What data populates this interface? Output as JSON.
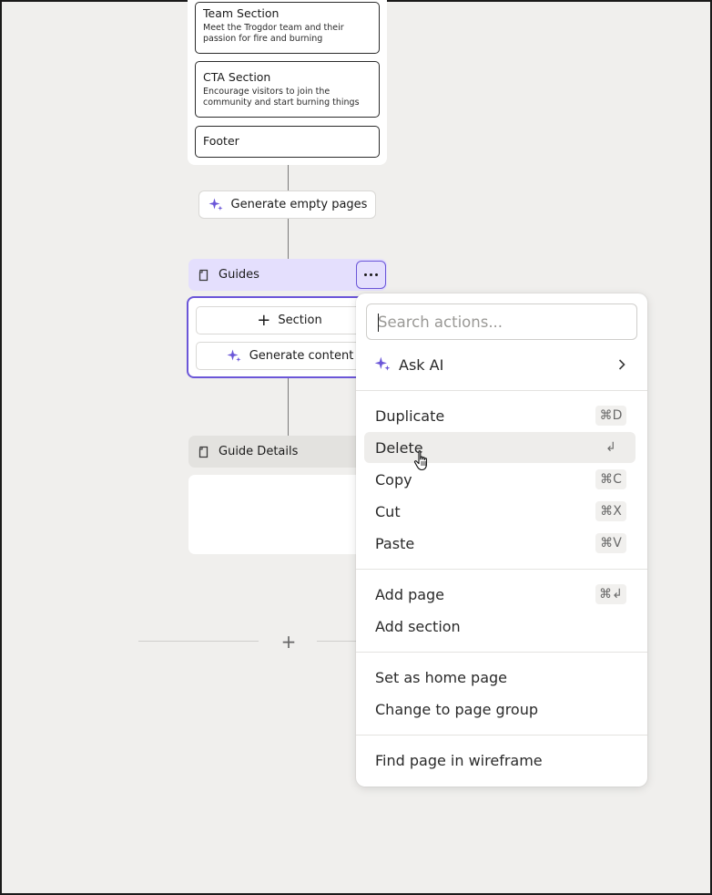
{
  "sitemap": {
    "sections": [
      {
        "title": "Team Section",
        "desc": "Meet the Trogdor team and their passion for fire and burning"
      },
      {
        "title": "CTA Section",
        "desc": "Encourage visitors to join the community and start burning things"
      },
      {
        "title": "Footer",
        "desc": ""
      }
    ],
    "generate_pages_label": "Generate empty pages",
    "guides_title": "Guides",
    "section_button_label": "Section",
    "generate_content_label": "Generate content",
    "guide_details_title": "Guide Details",
    "add_glyph": "+"
  },
  "menu": {
    "search_placeholder": "Search actions...",
    "ask_ai_label": "Ask AI",
    "items": [
      {
        "label": "Duplicate",
        "shortcut": "⌘D"
      },
      {
        "label": "Delete",
        "shortcut": "↲"
      },
      {
        "label": "Copy",
        "shortcut": "⌘C"
      },
      {
        "label": "Cut",
        "shortcut": "⌘X"
      },
      {
        "label": "Paste",
        "shortcut": "⌘V"
      },
      {
        "label": "Add page",
        "shortcut": "⌘↲"
      },
      {
        "label": "Add section",
        "shortcut": ""
      },
      {
        "label": "Set as home page",
        "shortcut": ""
      },
      {
        "label": "Change to page group",
        "shortcut": ""
      },
      {
        "label": "Find page in wireframe",
        "shortcut": ""
      }
    ]
  },
  "colors": {
    "accent": "#6b56d8",
    "accent_light": "#e4dffd",
    "background": "#f0efed"
  }
}
